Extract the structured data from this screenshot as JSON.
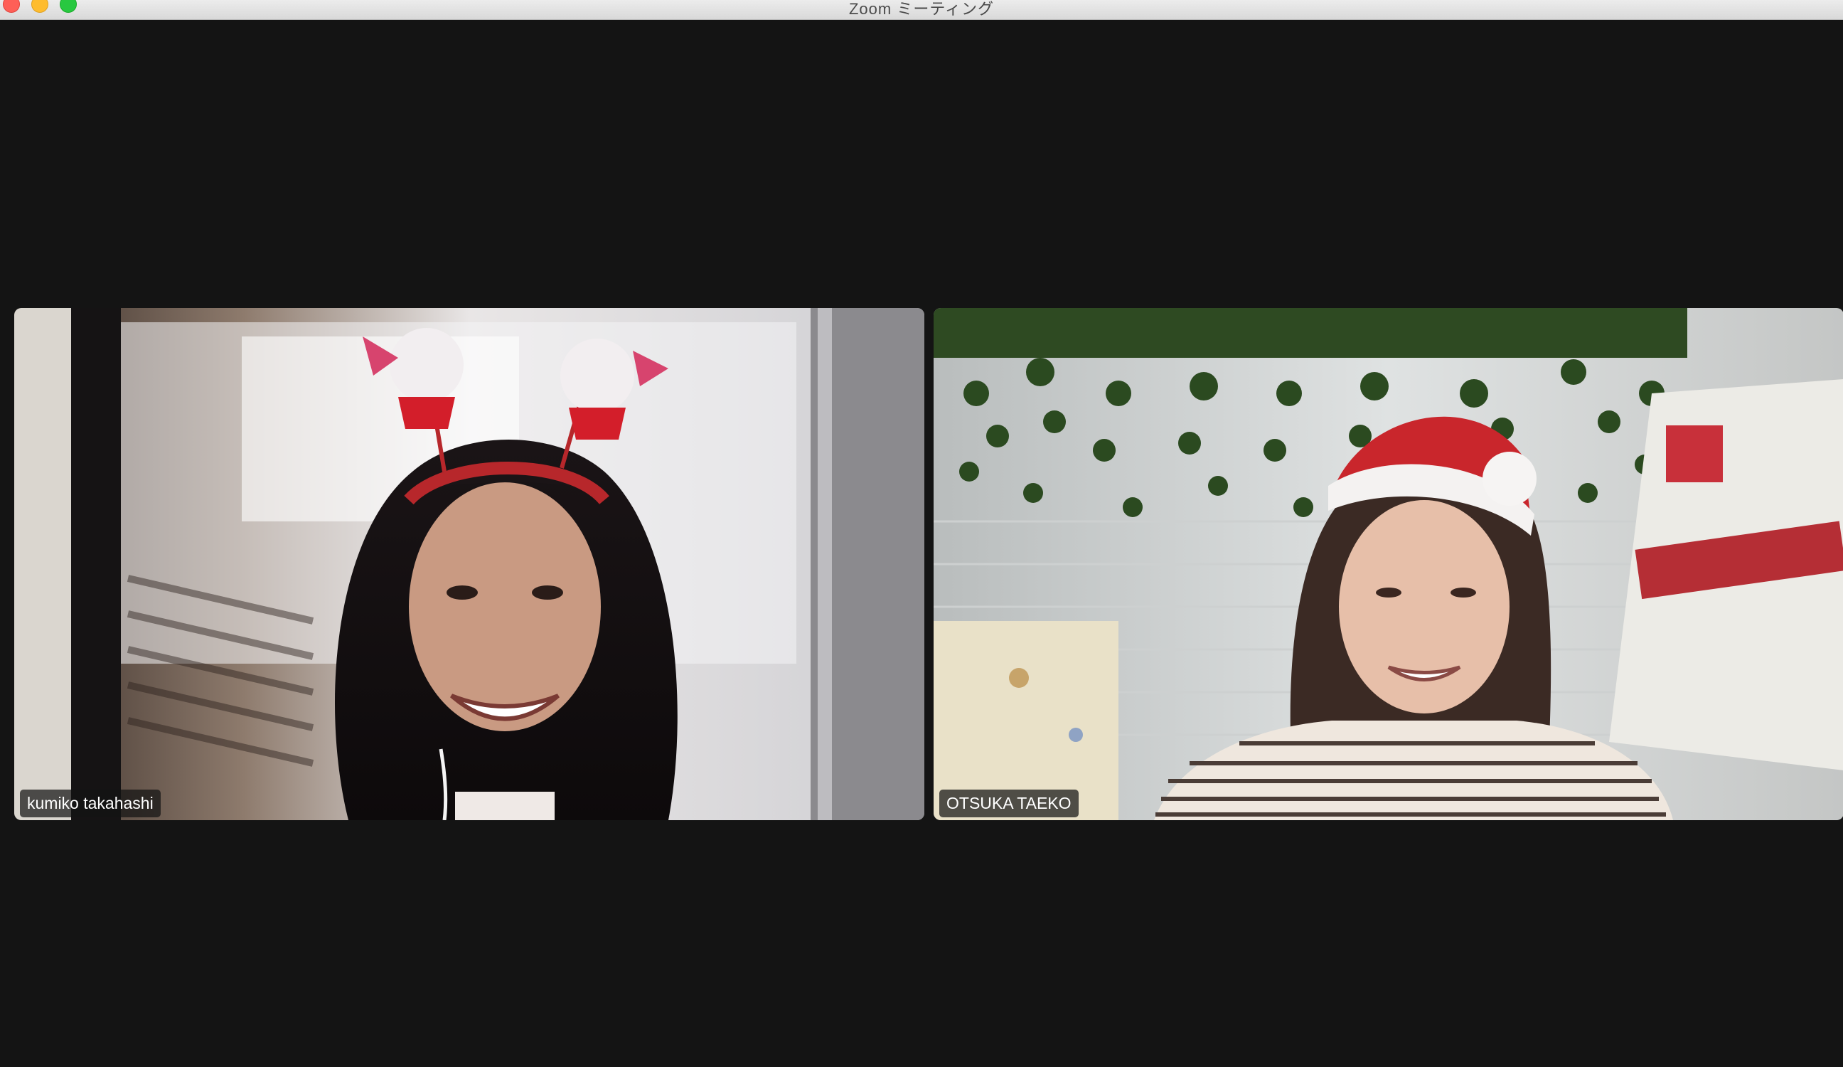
{
  "window": {
    "title": "Zoom ミーティング"
  },
  "colors": {
    "background": "#141414",
    "badge_bg": "#141414",
    "badge_text": "#ffffff"
  },
  "participants": [
    {
      "name": "kumiko takahashi",
      "video": "participant-video"
    },
    {
      "name": "OTSUKA TAEKO",
      "video": "participant-video"
    }
  ]
}
